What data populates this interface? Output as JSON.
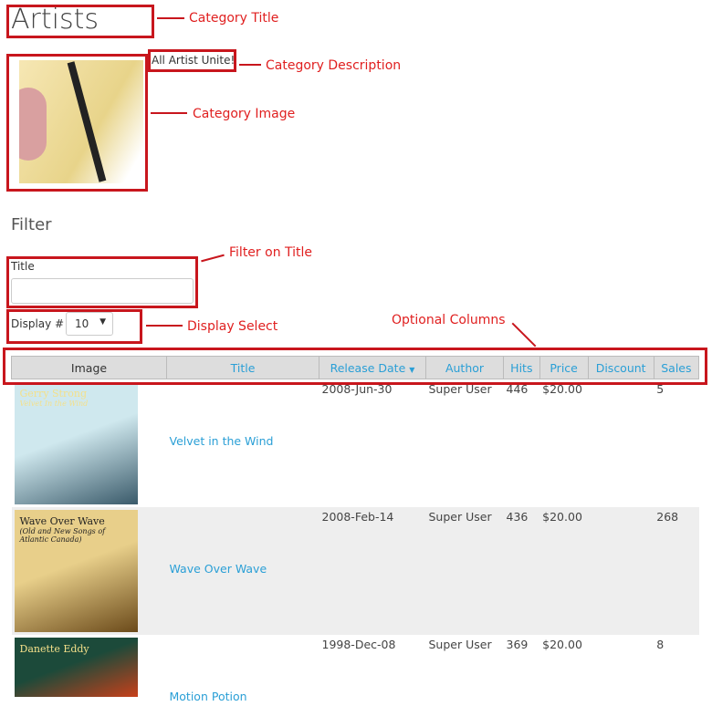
{
  "category": {
    "title": "Artists",
    "description": "All Artist Unite!"
  },
  "annotations": {
    "title": "Category Title",
    "description": "Category Description",
    "image": "Category Image",
    "filter_title": "Filter on Title",
    "display": "Display Select",
    "columns": "Optional Columns"
  },
  "filter": {
    "heading": "Filter",
    "title_label": "Title",
    "title_value": "",
    "display_label": "Display #",
    "display_value": "10"
  },
  "table": {
    "headers": [
      "Image",
      "Title",
      "Release Date",
      "Author",
      "Hits",
      "Price",
      "Discount",
      "Sales"
    ],
    "rows": [
      {
        "title": "Velvet in the Wind",
        "date": "2008-Jun-30",
        "author": "Super User",
        "hits": "446",
        "price": "$20.00",
        "discount": "",
        "sales": "5",
        "cover_text": "Gerry Strong",
        "cover_sub": "Velvet In the Wind"
      },
      {
        "title": "Wave Over Wave",
        "date": "2008-Feb-14",
        "author": "Super User",
        "hits": "436",
        "price": "$20.00",
        "discount": "",
        "sales": "268",
        "cover_text": "Wave Over Wave",
        "cover_sub": "(Old and New Songs of Atlantic Canada)"
      },
      {
        "title": "Motion Potion",
        "date": "1998-Dec-08",
        "author": "Super User",
        "hits": "369",
        "price": "$20.00",
        "discount": "",
        "sales": "8",
        "cover_text": "Danette Eddy",
        "cover_sub": ""
      }
    ]
  },
  "colors": {
    "annotation": "#c8161d",
    "link": "#2a9fd6"
  }
}
